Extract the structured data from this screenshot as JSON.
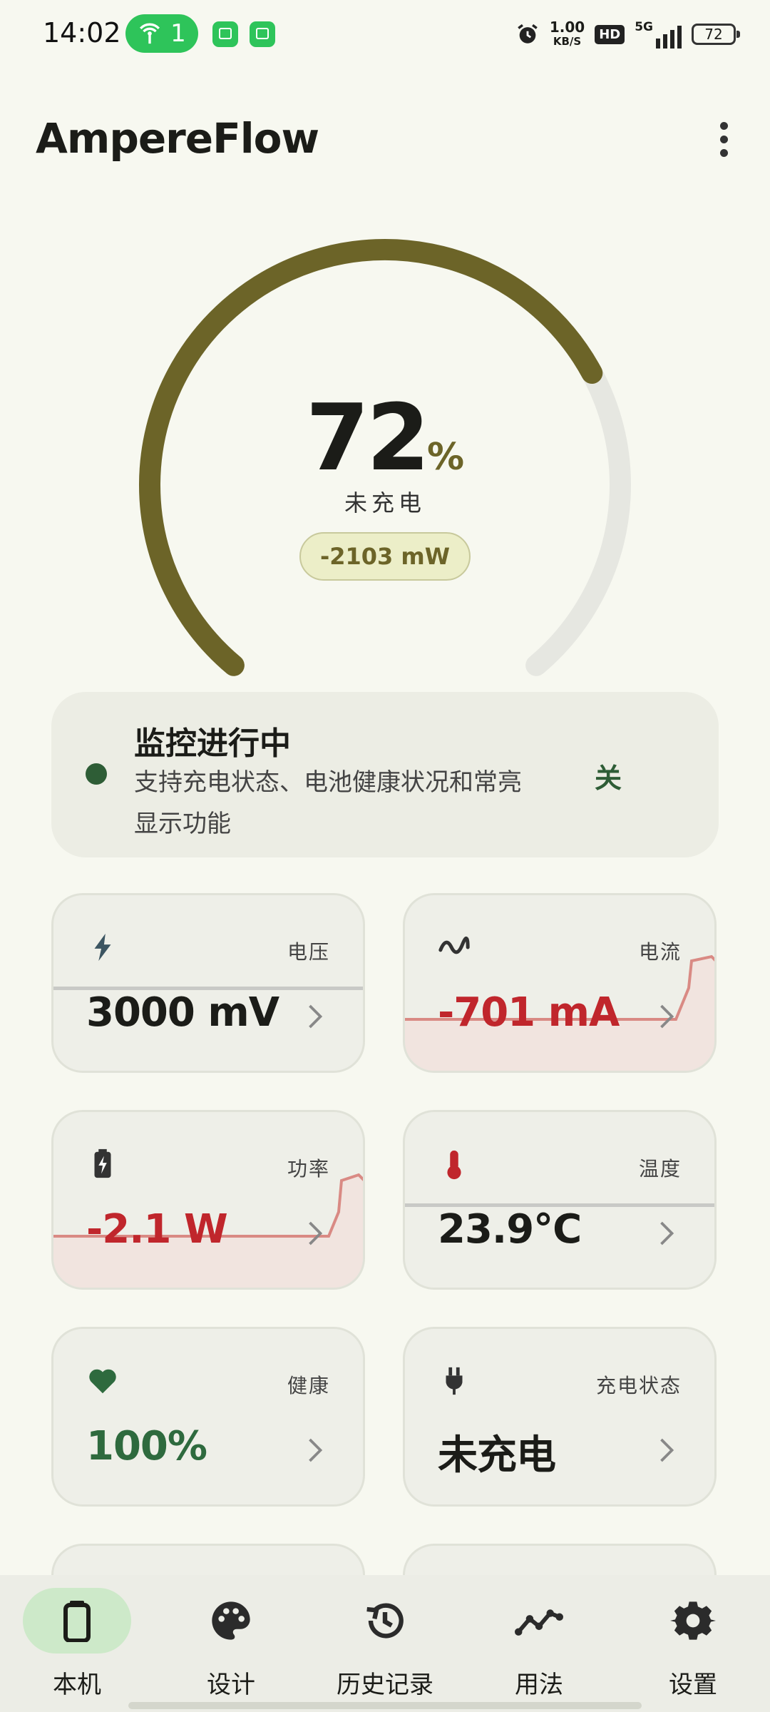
{
  "status_bar": {
    "time": "14:02",
    "hotspot_count": "1",
    "net_speed_value": "1.00",
    "net_speed_unit": "KB/S",
    "hd_badge": "HD",
    "network_type": "5G",
    "battery_level": "72"
  },
  "app_bar": {
    "title": "AmpereFlow"
  },
  "gauge": {
    "percent": "72",
    "percent_unit": "%",
    "fill_fraction": 0.72,
    "status": "未充电",
    "power": "-2103 mW",
    "colors": {
      "fill": "#6c6428",
      "track": "#e6e7e1"
    }
  },
  "monitor_card": {
    "title": "监控进行中",
    "description": "支持充电状态、电池健康状况和常亮显示功能",
    "toggle_label": "关"
  },
  "metrics": [
    {
      "label": "电压",
      "value": "3000 mV",
      "icon": "bolt-icon"
    },
    {
      "label": "电流",
      "value": "-701 mA",
      "icon": "wave-icon"
    },
    {
      "label": "功率",
      "value": "-2.1 W",
      "icon": "battery-charging-icon"
    },
    {
      "label": "温度",
      "value": "23.9°C",
      "icon": "thermometer-icon"
    },
    {
      "label": "健康",
      "value": "100%",
      "icon": "heart-icon"
    },
    {
      "label": "充电状态",
      "value": "未充电",
      "icon": "plug-icon"
    }
  ],
  "bottom_nav": {
    "items": [
      {
        "label": "本机",
        "icon": "battery-icon",
        "active": true
      },
      {
        "label": "设计",
        "icon": "palette-icon",
        "active": false
      },
      {
        "label": "历史记录",
        "icon": "history-icon",
        "active": false
      },
      {
        "label": "用法",
        "icon": "chart-line-icon",
        "active": false
      },
      {
        "label": "设置",
        "icon": "gear-icon",
        "active": false
      }
    ]
  },
  "colors": {
    "background": "#f7f8f0",
    "accent_olive": "#6c6428",
    "accent_green": "#2e5d36",
    "negative_red": "#c0262c"
  }
}
